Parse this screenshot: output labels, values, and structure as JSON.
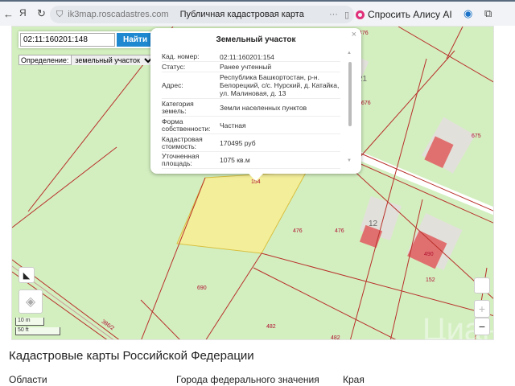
{
  "browser": {
    "url": "ik3map.roscadastres.com",
    "page_title": "Публичная кадастровая карта",
    "alice_label": "Спросить Алису AI"
  },
  "search": {
    "value": "02:11:160201:148",
    "button": "Найти"
  },
  "definition": {
    "label": "Определение:",
    "selected": "земельный участок"
  },
  "popup": {
    "title": "Земельный участок",
    "rows": [
      {
        "k": "Кад. номер:",
        "v": "02:11:160201:154"
      },
      {
        "k": "Статус:",
        "v": "Ранее учтенный"
      },
      {
        "k": "Адрес:",
        "v": "Республика Башкортостан, р-н. Белорецкий, с/с. Нурский, д. Катайка, ул. Малиновая, д. 13"
      },
      {
        "k": "Категория земель:",
        "v": "Земли населенных пунктов"
      },
      {
        "k": "Форма собственности:",
        "v": "Частная"
      },
      {
        "k": "Кадастровая стоимость:",
        "v": "170495 руб"
      },
      {
        "k": "Уточненная площадь:",
        "v": "1075 кв.м"
      }
    ]
  },
  "map": {
    "labels": [
      "476",
      "676",
      "675",
      "154",
      "476",
      "476",
      "12",
      "490",
      "152",
      "690",
      "386/2",
      "482",
      "482",
      "21"
    ],
    "scale": {
      "m": "10 m",
      "ft": "50 ft"
    },
    "zoom_in": "+",
    "zoom_out": "−",
    "watermark": "Циан"
  },
  "footer": {
    "title": "Кадастровые карты Российской Федерации",
    "columns": [
      "Области",
      "Города федерального значения",
      "Края"
    ]
  }
}
